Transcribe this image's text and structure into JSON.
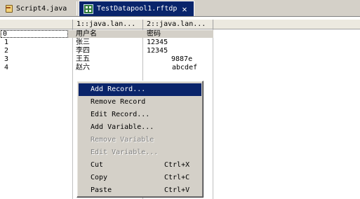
{
  "tabs": [
    {
      "label": "Script4.java",
      "icon": "java-file-icon",
      "active": false
    },
    {
      "label": "TestDatapool1.rftdp",
      "icon": "datapool-icon",
      "active": true,
      "close": "✕"
    }
  ],
  "grid": {
    "columns": [
      "",
      "1::java.lan...",
      "2::java.lan..."
    ],
    "rows": [
      {
        "index": "0",
        "c1": "用户名",
        "c2": "密码"
      },
      {
        "index": "1",
        "c1": "张三",
        "c2": "12345"
      },
      {
        "index": "2",
        "c1": "李四",
        "c2": "12345"
      },
      {
        "index": "3",
        "c1": "王五",
        "c2": "9887e"
      },
      {
        "index": "4",
        "c1": "赵六",
        "c2": "abcdef"
      }
    ]
  },
  "context_menu": {
    "items": [
      {
        "label": "Add Record...",
        "shortcut": "",
        "state": "highlighted"
      },
      {
        "label": "Remove Record",
        "shortcut": "",
        "state": "enabled"
      },
      {
        "label": "Edit Record...",
        "shortcut": "",
        "state": "enabled"
      },
      {
        "label": "Add Variable...",
        "shortcut": "",
        "state": "enabled"
      },
      {
        "label": "Remove Variable",
        "shortcut": "",
        "state": "disabled"
      },
      {
        "label": "Edit Variable...",
        "shortcut": "",
        "state": "disabled"
      },
      {
        "label": "Cut",
        "shortcut": "Ctrl+X",
        "state": "enabled"
      },
      {
        "label": "Copy",
        "shortcut": "Ctrl+C",
        "state": "enabled"
      },
      {
        "label": "Paste",
        "shortcut": "Ctrl+V",
        "state": "enabled"
      }
    ]
  },
  "colors": {
    "highlight": "#0a246a",
    "chrome": "#d4d0c8",
    "disabled_text": "#808080"
  }
}
